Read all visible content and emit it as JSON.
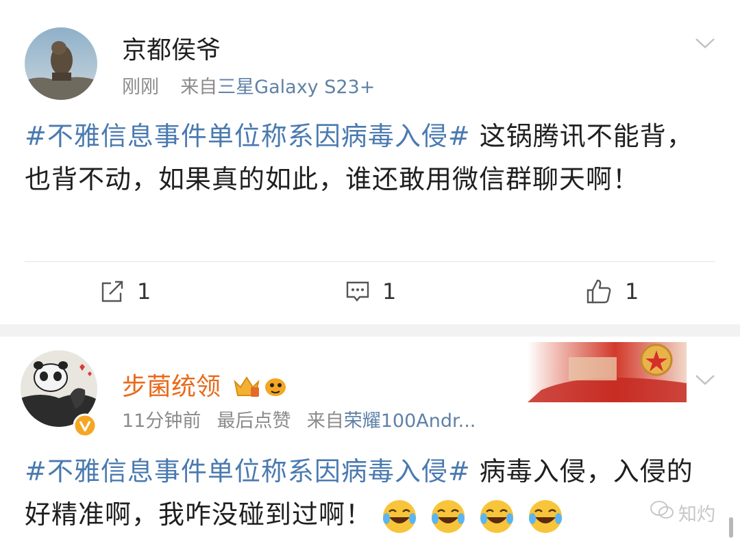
{
  "post1": {
    "username": "京都侯爷",
    "time": "刚刚",
    "source_prefix": "来自",
    "source_device": "三星Galaxy S23+",
    "hashtag": "#不雅信息事件单位称系因病毒入侵#",
    "text": "这锅腾讯不能背，也背不动，如果真的如此，谁还敢用微信群聊天啊！",
    "repost_count": "1",
    "comment_count": "1",
    "like_count": "1"
  },
  "post2": {
    "username": "步菌统领",
    "time": "11分钟前",
    "activity": "最后点赞",
    "source_prefix": "来自",
    "source_device": "荣耀100Andr...",
    "hashtag": "#不雅信息事件单位称系因病毒入侵#",
    "text": "病毒入侵，入侵的好精准啊，我咋没碰到过啊！",
    "emoji_count": 4
  },
  "watermark": {
    "text": "知灼"
  },
  "colors": {
    "hashtag": "#4a7ab0",
    "username_vip": "#e86a1a",
    "meta": "#8a8a8a",
    "source_link": "#5f81a6",
    "separator": "#f2f2f2"
  },
  "icons": {
    "more": "chevron-down-icon",
    "repost": "share-icon",
    "comment": "comment-icon",
    "like": "thumbs-up-icon",
    "verified": "verified-v-icon",
    "emoji": "laughing-tears-emoji"
  }
}
